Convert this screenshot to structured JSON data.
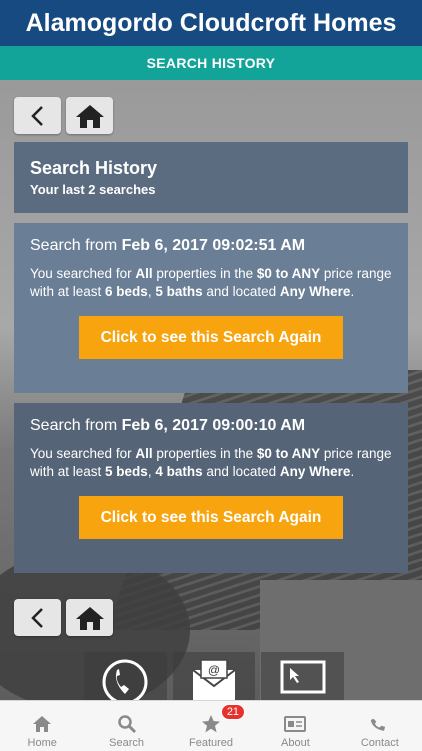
{
  "app": {
    "title": "Alamogordo Cloudcroft Homes"
  },
  "subheader": {
    "title": "SEARCH HISTORY"
  },
  "history_header": {
    "title": "Search History",
    "subtitle": "Your last 2 searches"
  },
  "searches": [
    {
      "prefix": "Search from ",
      "date": "Feb 6, 2017 09:02:51 AM",
      "t1": "You searched for ",
      "type": "All",
      "t2": " properties in the ",
      "price": "$0 to ANY",
      "t3": " price range with at least ",
      "beds": "6 beds",
      "t4": ", ",
      "baths": "5 baths",
      "t5": " and located ",
      "location": "Any Where",
      "t6": ".",
      "button": "Click to see this Search Again"
    },
    {
      "prefix": "Search from ",
      "date": "Feb 6, 2017 09:00:10 AM",
      "t1": "You searched for ",
      "type": "All",
      "t2": " properties in the ",
      "price": "$0 to ANY",
      "t3": " price range with at least ",
      "beds": "5 beds",
      "t4": ", ",
      "baths": "4 baths",
      "t5": " and located ",
      "location": "Any Where",
      "t6": ".",
      "button": "Click to see this Search Again"
    }
  ],
  "nav": {
    "back_icon": "back-icon",
    "home_icon": "home-icon"
  },
  "tabbar": {
    "items": [
      {
        "label": "Home",
        "icon": "home-icon"
      },
      {
        "label": "Search",
        "icon": "search-icon"
      },
      {
        "label": "Featured",
        "icon": "star-icon",
        "badge": "21"
      },
      {
        "label": "About",
        "icon": "id-card-icon"
      },
      {
        "label": "Contact",
        "icon": "phone-icon"
      }
    ]
  },
  "colors": {
    "header": "#164a80",
    "subheader": "#13a499",
    "button": "#f7a40f",
    "badge": "#e5322e"
  }
}
